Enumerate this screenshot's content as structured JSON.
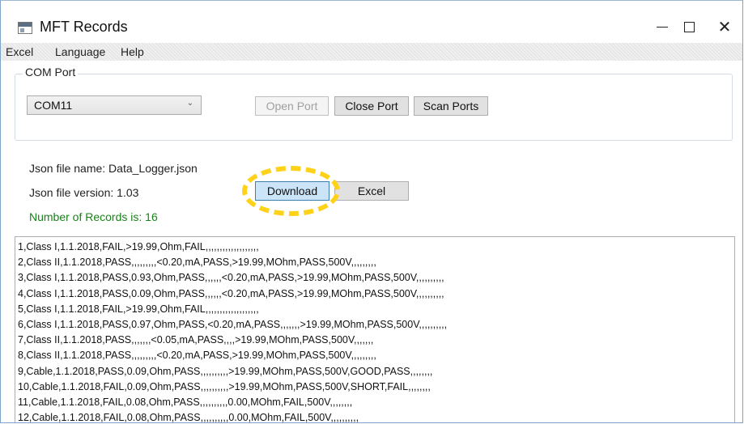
{
  "window": {
    "title": "MFT Records"
  },
  "menu": [
    "Excel",
    "Language",
    "Help"
  ],
  "com_port": {
    "group_label": "COM Port",
    "selected_port": "COM11",
    "open_port": "Open Port",
    "close_port": "Close Port",
    "scan_ports": "Scan Ports"
  },
  "info": {
    "json_file_name": "Json file name: Data_Logger.json",
    "json_file_version": "Json file version: 1.03",
    "records_count": "Number of Records is: 16"
  },
  "actions": {
    "download": "Download",
    "excel": "Excel"
  },
  "records": [
    "1,Class I,1.1.2018,FAIL,>19.99,Ohm,FAIL,,,,,,,,,,,,,,,,,,,",
    "2,Class II,1.1.2018,PASS,,,,,,,,,<0.20,mA,PASS,>19.99,MOhm,PASS,500V,,,,,,,,,",
    "3,Class I,1.1.2018,PASS,0.93,Ohm,PASS,,,,,,<0.20,mA,PASS,>19.99,MOhm,PASS,500V,,,,,,,,,,",
    "4,Class I,1.1.2018,PASS,0.09,Ohm,PASS,,,,,,<0.20,mA,PASS,>19.99,MOhm,PASS,500V,,,,,,,,,,",
    "5,Class I,1.1.2018,FAIL,>19.99,Ohm,FAIL,,,,,,,,,,,,,,,,,,,",
    "6,Class I,1.1.2018,PASS,0.97,Ohm,PASS,<0.20,mA,PASS,,,,,,,>19.99,MOhm,PASS,500V,,,,,,,,,,",
    "7,Class II,1.1.2018,PASS,,,,,,,<0.05,mA,PASS,,,,>19.99,MOhm,PASS,500V,,,,,,,",
    "8,Class II,1.1.2018,PASS,,,,,,,,,<0.20,mA,PASS,>19.99,MOhm,PASS,500V,,,,,,,,,",
    "9,Cable,1.1.2018,PASS,0.09,Ohm,PASS,,,,,,,,,,>19.99,MOhm,PASS,500V,GOOD,PASS,,,,,,,,",
    "10,Cable,1.1.2018,FAIL,0.09,Ohm,PASS,,,,,,,,,,>19.99,MOhm,PASS,500V,SHORT,FAIL,,,,,,,,",
    "11,Cable,1.1.2018,FAIL,0.08,Ohm,PASS,,,,,,,,,,0.00,MOhm,FAIL,500V,,,,,,,,",
    "12,Cable,1.1.2018,FAIL,0.08,Ohm,PASS,,,,,,,,,,0.00,MOhm,FAIL,500V,,,,,,,,,,"
  ]
}
